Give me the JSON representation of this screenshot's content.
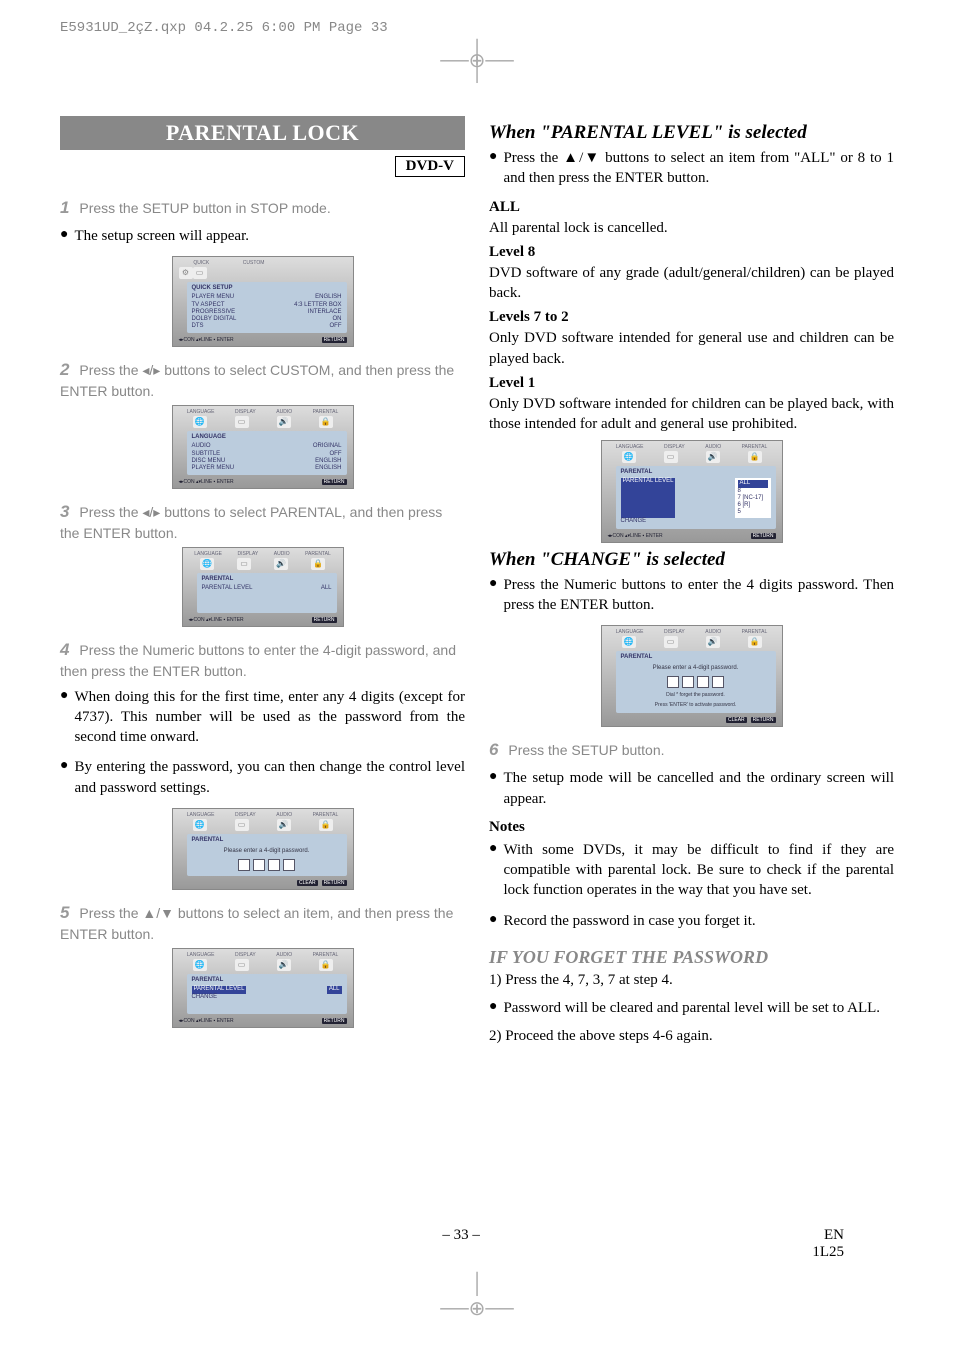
{
  "header_line": "E5931UD_2çZ.qxp  04.2.25  6:00 PM  Page 33",
  "title": "PARENTAL LOCK",
  "dvdv": "DVD-V",
  "left": {
    "step1": "Press the SETUP button in STOP mode.",
    "step1_body": "The setup screen will appear.",
    "osd1": {
      "tabs": [
        "QUICK",
        "CUSTOM"
      ],
      "title": "QUICK SETUP",
      "rows": [
        [
          "PLAYER MENU",
          "ENGLISH"
        ],
        [
          "TV ASPECT",
          "4:3 LETTER BOX"
        ],
        [
          "PROGRESSIVE",
          "INTERLACE"
        ],
        [
          "DOLBY DIGITAL",
          "ON"
        ],
        [
          "DTS",
          "OFF"
        ]
      ]
    },
    "step2": "Press the ◂/▸ buttons to select CUSTOM, and then press the ENTER button.",
    "osd2": {
      "tabs": [
        "LANGUAGE",
        "DISPLAY",
        "AUDIO",
        "PARENTAL"
      ],
      "title": "LANGUAGE",
      "rows": [
        [
          "AUDIO",
          "ORIGINAL"
        ],
        [
          "SUBTITLE",
          "OFF"
        ],
        [
          "DISC MENU",
          "ENGLISH"
        ],
        [
          "PLAYER MENU",
          "ENGLISH"
        ]
      ]
    },
    "step3": "Press the ◂/▸ buttons to select PARENTAL, and then press the ENTER button.",
    "osd3": {
      "tabs": [
        "LANGUAGE",
        "DISPLAY",
        "AUDIO",
        "PARENTAL"
      ],
      "title": "PARENTAL",
      "rows": [
        [
          "PARENTAL LEVEL",
          "ALL"
        ]
      ]
    },
    "step4": "Press the Numeric buttons to enter the 4-digit password, and then press the ENTER button.",
    "step4_body1": "When doing this for the first time, enter any 4 digits (except for 4737). This number will be used as the password from the second time onward.",
    "step4_body2": "By entering the password, you can then change the control level and password settings.",
    "osd4": {
      "tabs": [
        "LANGUAGE",
        "DISPLAY",
        "AUDIO",
        "PARENTAL"
      ],
      "title": "PARENTAL",
      "msg": "Please enter a 4-digit password.",
      "footer": [
        "CLEAR",
        "RETURN"
      ]
    },
    "step5": "Press the ▲/▼ buttons to select an item, and then press the ENTER button.",
    "osd5": {
      "tabs": [
        "LANGUAGE",
        "DISPLAY",
        "AUDIO",
        "PARENTAL"
      ],
      "title": "PARENTAL",
      "rows": [
        [
          "PARENTAL LEVEL",
          "ALL"
        ],
        [
          "CHANGE",
          ""
        ]
      ]
    }
  },
  "right": {
    "h_parental": "When \"PARENTAL LEVEL\" is selected",
    "parental_body": "Press the ▲/▼ buttons to select an item from \"ALL\" or 8 to 1 and then press the ENTER button.",
    "all_head": "ALL",
    "all_body": "All parental lock is cancelled.",
    "l8_head": "Level 8",
    "l8_body": "DVD software of any grade (adult/general/children) can be played back.",
    "l72_head": "Levels 7 to 2",
    "l72_body": "Only DVD software intended for general use and children can be played back.",
    "l1_head": "Level 1",
    "l1_body": "Only DVD software intended for children can be played back, with those intended for adult and general use prohibited.",
    "osd6": {
      "tabs": [
        "LANGUAGE",
        "DISPLAY",
        "AUDIO",
        "PARENTAL"
      ],
      "title": "PARENTAL",
      "row_label": "PARENTAL LEVEL",
      "row2": "CHANGE",
      "list": [
        "ALL",
        "8",
        "7 [NC-17]",
        "6 [R]",
        "5"
      ]
    },
    "h_change": "When \"CHANGE\" is selected",
    "change_body": "Press the Numeric buttons to enter the 4 digits password. Then press the ENTER button.",
    "osd7": {
      "tabs": [
        "LANGUAGE",
        "DISPLAY",
        "AUDIO",
        "PARENTAL"
      ],
      "title": "PARENTAL",
      "msg1": "Please enter a 4-digit password.",
      "msg2": "Dial * forget the password.",
      "msg3": "Press 'ENTER' to activate password.",
      "footer": [
        "CLEAR",
        "RETURN"
      ]
    },
    "step6": "Press the SETUP button.",
    "step6_body": "The setup mode will be cancelled and the ordinary screen will appear.",
    "notes_head": "Notes",
    "note1": "With some DVDs, it may be difficult to find if they are compatible with parental lock. Be sure to check if the parental lock function operates in the way that you have set.",
    "note2": "Record the password in case you forget it.",
    "forget_head": "IF YOU FORGET THE PASSWORD",
    "forget1": "1) Press the 4, 7, 3, 7 at step 4.",
    "forget2": "Password will be cleared and parental level will be set to ALL.",
    "forget3": "2) Proceed the above steps 4-6 again."
  },
  "osd_footer_nav": "◂▸CON  ▴▾LINE  ▪ ENTER",
  "osd_footer_return": "RETURN",
  "page_num": "– 33 –",
  "page_lang": "EN",
  "page_code": "1L25"
}
